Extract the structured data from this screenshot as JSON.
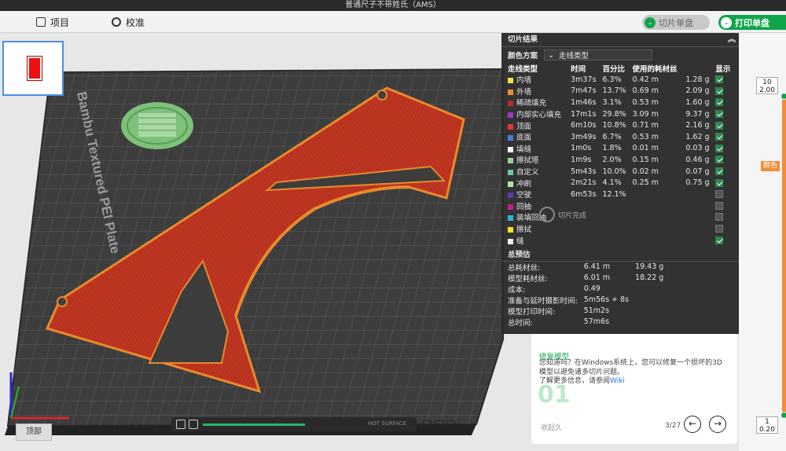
{
  "window": {
    "title": "普通尺子不带姓氏（AMS）"
  },
  "toolbar": {
    "tab_project": "项目",
    "tab_preview": "校准",
    "slice_button": "切片单盘",
    "print_button": "打印单盘",
    "caret": "⌄"
  },
  "plate": {
    "thumb_number": "1",
    "brand_text": "Bambu Textured PEI Plate",
    "view_label": "顶部"
  },
  "slice_result": {
    "title": "切片结果",
    "color_scheme_label": "颜色方案",
    "color_scheme_value": "走线类型",
    "columns": [
      "走线类型",
      "时间",
      "百分比",
      "使用的耗材丝",
      "",
      "显示"
    ],
    "rows": [
      {
        "name": "内墙",
        "time": "3m37s",
        "percent": "6.3%",
        "length": "0.42 m",
        "weight": "1.28 g",
        "color": "#f2e24a",
        "shown": true
      },
      {
        "name": "外墙",
        "time": "7m47s",
        "percent": "13.7%",
        "length": "0.69 m",
        "weight": "2.09 g",
        "color": "#f28c2e",
        "shown": true
      },
      {
        "name": "稀疏填充",
        "time": "1m46s",
        "percent": "3.1%",
        "length": "0.53 m",
        "weight": "1.60 g",
        "color": "#b22e2e",
        "shown": true
      },
      {
        "name": "内部实心填充",
        "time": "17m1s",
        "percent": "29.8%",
        "length": "3.09 m",
        "weight": "9.37 g",
        "color": "#a035c9",
        "shown": true
      },
      {
        "name": "顶面",
        "time": "6m10s",
        "percent": "10.8%",
        "length": "0.71 m",
        "weight": "2.16 g",
        "color": "#e63232",
        "shown": true
      },
      {
        "name": "底面",
        "time": "3m49s",
        "percent": "6.7%",
        "length": "0.53 m",
        "weight": "1.62 g",
        "color": "#4a7ad6",
        "shown": true
      },
      {
        "name": "填缝",
        "time": "1m0s",
        "percent": "1.8%",
        "length": "0.01 m",
        "weight": "0.03 g",
        "color": "#f4f4f4",
        "shown": true
      },
      {
        "name": "擦拭塔",
        "time": "1m9s",
        "percent": "2.0%",
        "length": "0.15 m",
        "weight": "0.46 g",
        "color": "#9ad39a",
        "shown": true
      },
      {
        "name": "自定义",
        "time": "5m43s",
        "percent": "10.0%",
        "length": "0.02 m",
        "weight": "0.07 g",
        "color": "#6fc5a8",
        "shown": true
      },
      {
        "name": "冲刷",
        "time": "2m21s",
        "percent": "4.1%",
        "length": "0.25 m",
        "weight": "0.75 g",
        "color": "#b8e6a8",
        "shown": true
      },
      {
        "name": "空驶",
        "time": "6m53s",
        "percent": "12.1%",
        "length": "",
        "weight": "",
        "color": "#5a3ea8",
        "shown": false
      },
      {
        "name": "回抽",
        "time": "",
        "percent": "",
        "length": "",
        "weight": "",
        "color": "#c41e8a",
        "shown": false
      },
      {
        "name": "装填回抽",
        "time": "",
        "percent": "",
        "length": "",
        "weight": "",
        "color": "#2ab4d6",
        "shown": false
      },
      {
        "name": "擦拭",
        "time": "",
        "percent": "",
        "length": "",
        "weight": "",
        "color": "#f2e61a",
        "shown": false
      },
      {
        "name": "缝",
        "time": "",
        "percent": "",
        "length": "",
        "weight": "",
        "color": "#f4f4f4",
        "shown": true
      }
    ],
    "estimate_title": "总预估",
    "estimates": [
      {
        "label": "总耗材丝:",
        "v1": "6.41 m",
        "v2": "19.43 g"
      },
      {
        "label": "模型耗材丝:",
        "v1": "6.01 m",
        "v2": "18.22 g"
      },
      {
        "label": "成本:",
        "v1": "0.49",
        "v2": ""
      },
      {
        "label": "准备与延时摄影时间:",
        "v1": "5m56s + 8s",
        "v2": ""
      },
      {
        "label": "模型打印时间:",
        "v1": "51m2s",
        "v2": ""
      },
      {
        "label": "总时间:",
        "v1": "57m6s",
        "v2": ""
      }
    ],
    "done_label": "切片完成"
  },
  "tips": {
    "title": "修复模型",
    "body": "您知道吗？在Windows系统上，您可以修复一个损坏的3D模型以避免诸多切片问题。",
    "more": "了解更多信息，请参阅",
    "wiki": "Wiki",
    "big_number": "01",
    "collapse": "收起久",
    "pager": "3/27",
    "prev": "←",
    "next": "→"
  },
  "layer_slider": {
    "top_layer": "10",
    "top_height": "2.00",
    "bottom_layer": "1",
    "bottom_height": "0.20",
    "color_tag": "颜色"
  },
  "bottom_bar": {
    "hot_surface": "HOT SURFACE"
  }
}
